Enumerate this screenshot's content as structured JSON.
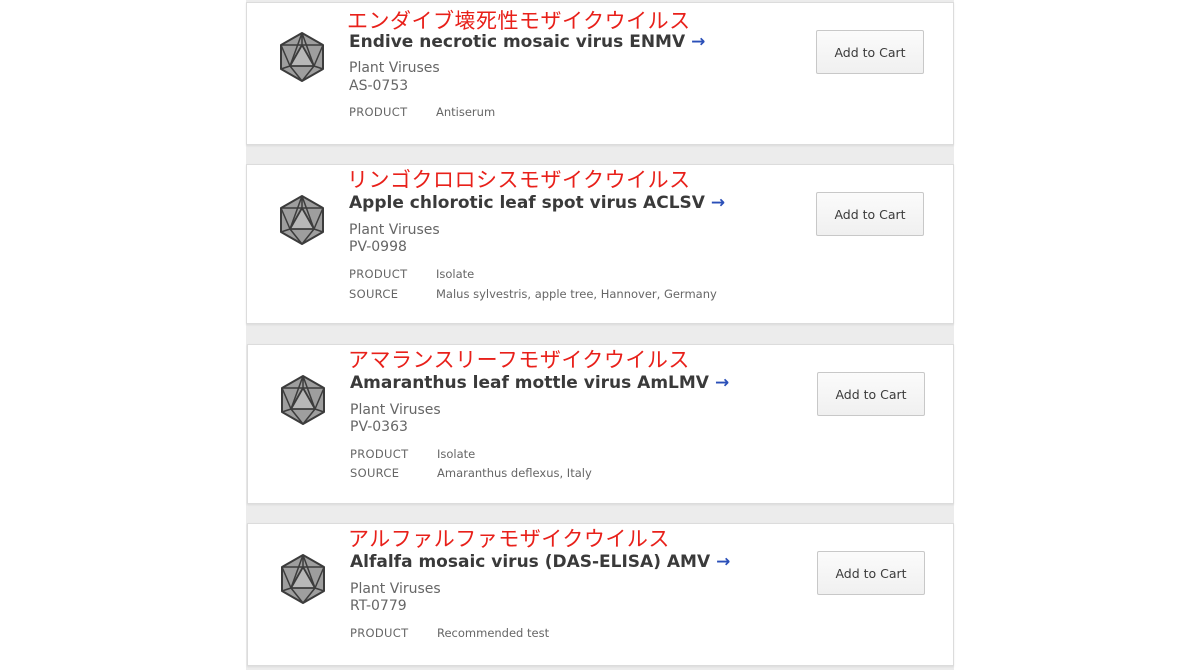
{
  "product_list": {
    "items": [
      {
        "japanese_name": "エンダイブ壊死性モザイクウイルス",
        "name": "Endive necrotic mosaic virus ENMV",
        "arrow": "→",
        "category": "Plant Viruses",
        "code": "AS-0753",
        "properties": [
          {
            "key": "PRODUCT",
            "value": "Antiserum"
          }
        ],
        "cart_label": "Add to Cart"
      },
      {
        "japanese_name": "リンゴクロロシスモザイクウイルス",
        "name": "Apple chlorotic leaf spot virus ACLSV",
        "arrow": "→",
        "category": "Plant Viruses",
        "code": "PV-0998",
        "properties": [
          {
            "key": "PRODUCT",
            "value": "Isolate"
          },
          {
            "key": "SOURCE",
            "value": "Malus sylvestris, apple tree, Hannover, Germany"
          }
        ],
        "cart_label": "Add to Cart"
      },
      {
        "japanese_name": "アマランスリーフモザイクウイルス",
        "name": "Amaranthus leaf mottle virus AmLMV",
        "arrow": "→",
        "category": "Plant Viruses",
        "code": "PV-0363",
        "properties": [
          {
            "key": "PRODUCT",
            "value": "Isolate"
          },
          {
            "key": "SOURCE",
            "value": "Amaranthus deflexus, Italy"
          }
        ],
        "cart_label": "Add to Cart"
      },
      {
        "japanese_name": "アルファルファモザイクウイルス",
        "name": "Alfalfa mosaic virus (DAS-ELISA) AMV",
        "arrow": "→",
        "category": "Plant Viruses",
        "code": "RT-0779",
        "properties": [
          {
            "key": "PRODUCT",
            "value": "Recommended test"
          }
        ],
        "cart_label": "Add to Cart"
      }
    ]
  },
  "colors": {
    "annotation_red": "#e8201a",
    "arrow_blue": "#2a4fb8",
    "title_text": "#3a3a3a"
  },
  "icons": {
    "product": "virus-icosahedron-icon",
    "link": "arrow-right-icon"
  }
}
